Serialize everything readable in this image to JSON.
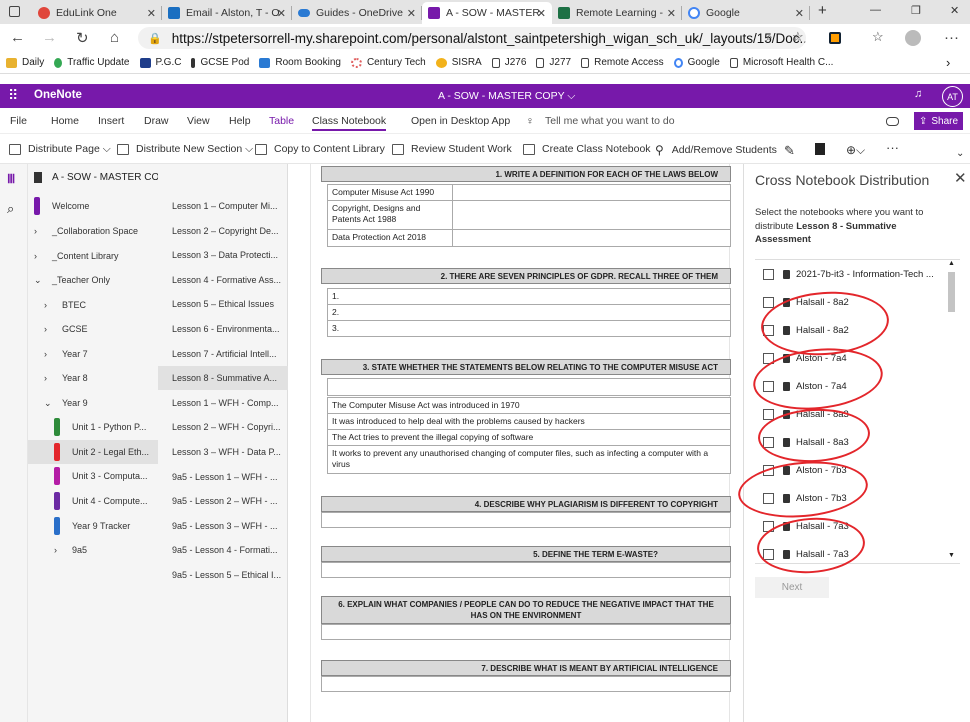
{
  "browser": {
    "tabs": [
      {
        "label": "EduLink One",
        "color": "#e0463b"
      },
      {
        "label": "Email - Alston, T - O",
        "color": "#1b6fc1"
      },
      {
        "label": "Guides - OneDrive",
        "color": "#2a7ad3"
      },
      {
        "label": "A - SOW - MASTER",
        "color": "#7719aa"
      },
      {
        "label": "Remote Learning -",
        "color": "#1e7145"
      },
      {
        "label": "Google",
        "color": "#ffffff"
      }
    ],
    "new_tab": "+",
    "url": "https://stpetersorrell-my.sharepoint.com/personal/alstont_saintpetershigh_wigan_sch_uk/_layouts/15/Doc....",
    "bookmarks": [
      "Daily",
      "Traffic Update",
      "P.G.C",
      "GCSE Pod",
      "Room Booking",
      "Century Tech",
      "SISRA",
      "J276",
      "J277",
      "Remote Access",
      "Google",
      "Microsoft Health C..."
    ]
  },
  "app": {
    "name": "OneNote",
    "doc_title": "A - SOW - MASTER COPY ⌵",
    "initials": "AT",
    "ribbon_tabs": [
      "File",
      "Home",
      "Insert",
      "Draw",
      "View",
      "Help",
      "Table",
      "Class Notebook",
      "Open in Desktop App",
      "Tell me what you want to do"
    ],
    "share": "Share",
    "toolbar": [
      "Distribute Page ⌵",
      "Distribute New Section ⌵",
      "Copy to Content Library",
      "Review Student Work",
      "Create Class Notebook",
      "Add/Remove Students"
    ]
  },
  "notebook": {
    "title": "A - SOW - MASTER COPY",
    "sections": [
      {
        "label": "Welcome",
        "color": "#7719aa",
        "chev": ""
      },
      {
        "label": "_Collaboration Space",
        "color": "",
        "chev": "›"
      },
      {
        "label": "_Content Library",
        "color": "",
        "chev": "›"
      },
      {
        "label": "_Teacher Only",
        "color": "",
        "chev": "⌄"
      },
      {
        "label": "BTEC",
        "color": "",
        "chev": "›"
      },
      {
        "label": "GCSE",
        "color": "",
        "chev": "›"
      },
      {
        "label": "Year 7",
        "color": "",
        "chev": "›"
      },
      {
        "label": "Year 8",
        "color": "",
        "chev": "›"
      },
      {
        "label": "Year 9",
        "color": "",
        "chev": "⌄"
      },
      {
        "label": "Unit 1 - Python P...",
        "color": "#2e8b3a",
        "chev": ""
      },
      {
        "label": "Unit 2 - Legal Eth...",
        "color": "#e3262b",
        "chev": ""
      },
      {
        "label": "Unit 3 - Computa...",
        "color": "#b41da6",
        "chev": ""
      },
      {
        "label": "Unit 4 - Compute...",
        "color": "#6b2aa3",
        "chev": ""
      },
      {
        "label": "Year 9 Tracker",
        "color": "#2a6fc9",
        "chev": ""
      },
      {
        "label": "9a5",
        "color": "",
        "chev": "›"
      }
    ],
    "pages": [
      "Lesson 1 – Computer Mi...",
      "Lesson 2 – Copyright De...",
      "Lesson 3 – Data Protecti...",
      "Lesson 4 - Formative Ass...",
      "Lesson 5 – Ethical Issues",
      "Lesson 6 - Environmenta...",
      "Lesson 7 - Artificial Intell...",
      "Lesson 8 - Summative A...",
      "Lesson 1 – WFH - Comp...",
      "Lesson 2 – WFH - Copyri...",
      "Lesson 3 – WFH - Data P...",
      "9a5 - Lesson 1 – WFH - ...",
      "9a5 - Lesson 2 – WFH - ...",
      "9a5 - Lesson 3 – WFH - ...",
      "9a5 - Lesson 4 - Formati...",
      "9a5 - Lesson 5 – Ethical I..."
    ]
  },
  "document": {
    "q1": "1.   WRITE A DEFINITION FOR EACH OF THE LAWS BELOW",
    "q1_rows": [
      "Computer Misuse Act 1990",
      "Copyright, Designs and Patents Act 1988",
      "Data Protection Act 2018"
    ],
    "q2": "2.   THERE ARE SEVEN PRINCIPLES OF GDPR. RECALL THREE OF THEM",
    "q2_rows": [
      "1.",
      "2.",
      "3."
    ],
    "q3": "3.   STATE WHETHER THE STATEMENTS BELOW RELATING TO THE COMPUTER MISUSE ACT",
    "q3_rows": [
      "The Computer Misuse Act was introduced in 1970",
      "It was introduced to help deal with the problems caused by hackers",
      "The Act tries to prevent the illegal copying of software",
      "It works to prevent any unauthorised changing of computer files, such as infecting a computer with a virus"
    ],
    "q4": "4.   DESCRIBE WHY PLAGIARISM IS DIFFERENT TO COPYRIGHT",
    "q5": "5.   DEFINE THE TERM E-WASTE?",
    "q6": "6.   EXPLAIN WHAT COMPANIES / PEOPLE CAN DO TO REDUCE THE NEGATIVE IMPACT THAT THE",
    "q6b": "HAS ON THE ENVIRONMENT",
    "q7": "7.   DESCRIBE WHAT IS MEANT BY ARTIFICIAL INTELLIGENCE"
  },
  "panel": {
    "title": "Cross Notebook Distribution",
    "instr1": "Select the notebooks where you want to distribute ",
    "instr_bold": "Lesson 8 - Summative Assessment",
    "notebooks": [
      "2021-7b-it3 - Information-Tech ...",
      "Halsall - 8a2",
      "Halsall - 8a2",
      "Alston - 7a4",
      "Alston - 7a4",
      "Halsall - 8a3",
      "Halsall - 8a3",
      "Alston - 7b3",
      "Alston - 7b3",
      "Halsall - 7a3",
      "Halsall - 7a3"
    ],
    "next": "Next"
  }
}
